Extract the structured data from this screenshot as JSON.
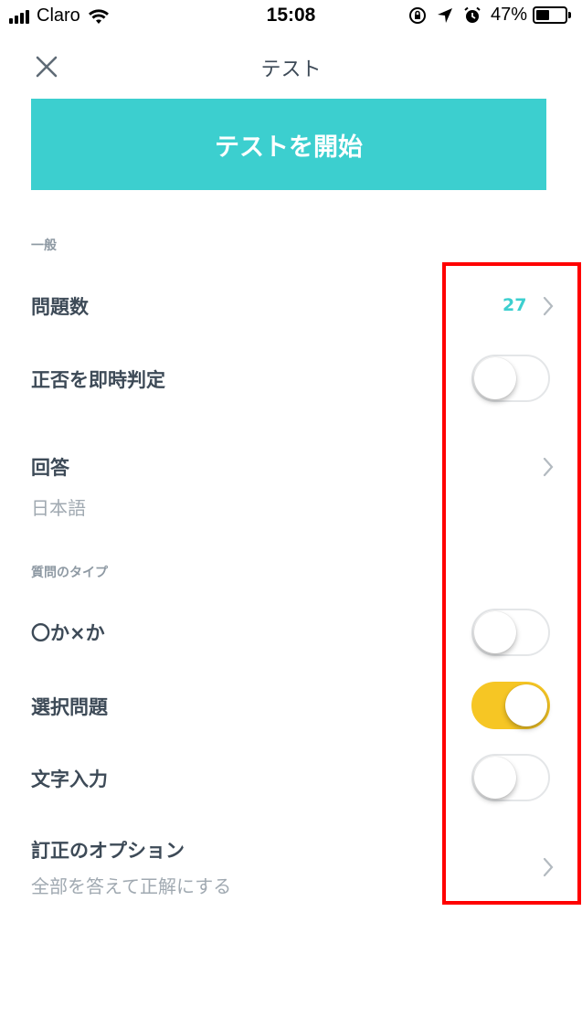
{
  "status_bar": {
    "carrier": "Claro",
    "time": "15:08",
    "battery_percent": "47%",
    "battery_level": 0.47,
    "icons": [
      "signal-icon",
      "wifi-icon",
      "rotation-lock-icon",
      "location-icon",
      "alarm-icon",
      "battery-icon"
    ]
  },
  "nav": {
    "title": "テスト",
    "close_icon": "close-icon"
  },
  "start_button": {
    "label": "テストを開始",
    "color": "#3ccfcf"
  },
  "sections": {
    "general": "一般",
    "question_types": "質問のタイプ"
  },
  "settings": {
    "question_count": {
      "label": "問題数",
      "value": "27"
    },
    "instant_grading": {
      "label": "正否を即時判定",
      "on": false
    },
    "answer": {
      "label": "回答",
      "value": "日本語"
    },
    "true_false": {
      "label": "〇か×か",
      "on": false
    },
    "multiple_choice": {
      "label": "選択問題",
      "on": true
    },
    "text_input": {
      "label": "文字入力",
      "on": false
    },
    "correction_options": {
      "label": "訂正のオプション",
      "value": "全部を答えて正解にする"
    }
  },
  "colors": {
    "accent": "#3ccfcf",
    "toggle_on": "#f6c624",
    "highlight": "#ff0000"
  }
}
